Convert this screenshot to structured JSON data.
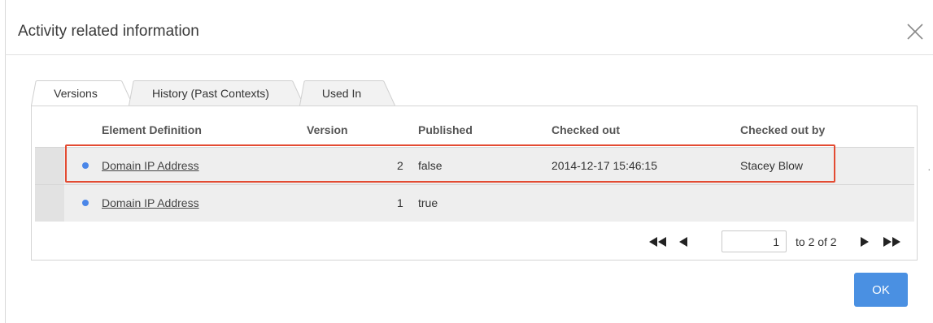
{
  "dialog": {
    "title": "Activity related information",
    "close_icon": "close-icon"
  },
  "tabs": [
    {
      "label": "Versions",
      "active": true
    },
    {
      "label": "History (Past Contexts)",
      "active": false
    },
    {
      "label": "Used In",
      "active": false
    }
  ],
  "table": {
    "columns": [
      "Element Definition",
      "Version",
      "Published",
      "Checked out",
      "Checked out by"
    ],
    "rows": [
      {
        "name": "Domain IP Address",
        "version": "2",
        "published": "false",
        "checked_out": "2014-12-17 15:46:15",
        "checked_out_by": "Stacey Blow",
        "highlighted": true
      },
      {
        "name": "Domain IP Address",
        "version": "1",
        "published": "true",
        "checked_out": "",
        "checked_out_by": "",
        "highlighted": false
      }
    ]
  },
  "pagination": {
    "first_icon": "first-page-icon",
    "prev_icon": "prev-page-icon",
    "next_icon": "next-page-icon",
    "last_icon": "last-page-icon",
    "page_value": "1",
    "range_text": "to 2 of 2"
  },
  "footer": {
    "ok_label": "OK"
  },
  "colors": {
    "accent": "#4a90e2",
    "highlight_border": "#e34b32",
    "row_bg": "#eeeeee",
    "bullet": "#4a86e8"
  }
}
